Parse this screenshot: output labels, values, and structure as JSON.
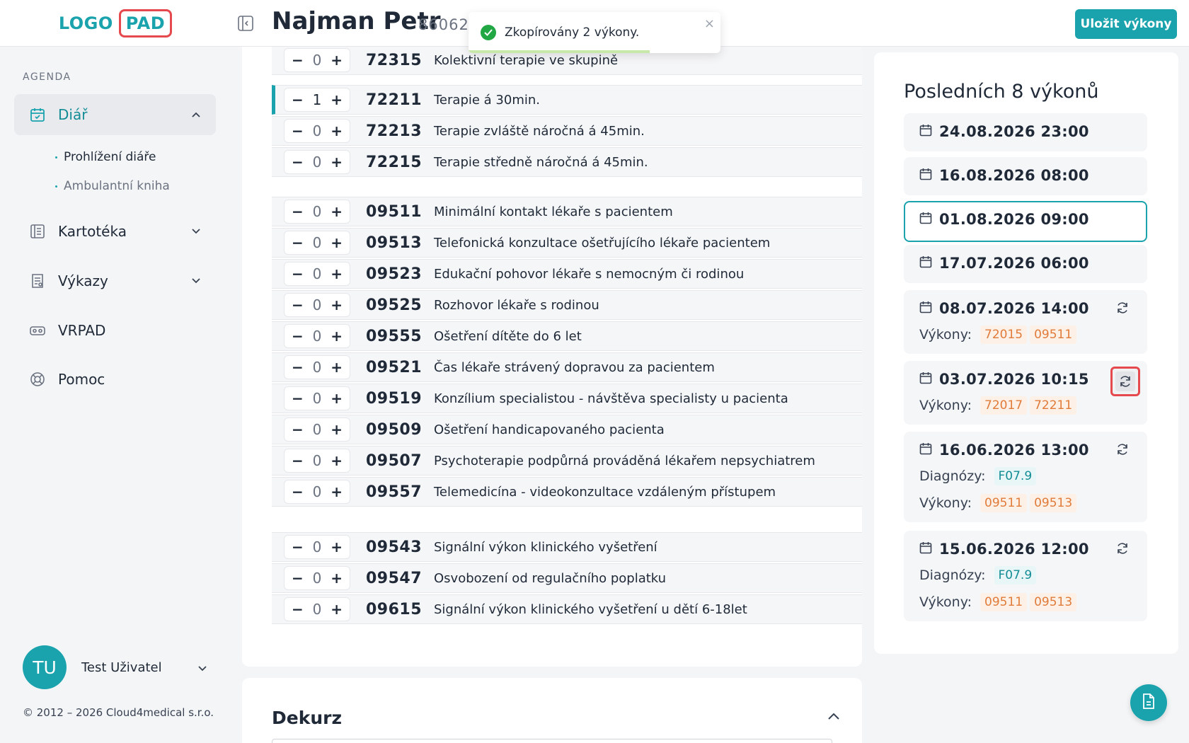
{
  "logo": {
    "part1": "LOGO",
    "part2": "PAD"
  },
  "sidebar": {
    "section_label": "AGENDA",
    "items": [
      {
        "label": "Diář",
        "icon": "calendar-icon"
      },
      {
        "label": "Kartotéka",
        "icon": "card-index-icon"
      },
      {
        "label": "Výkazy",
        "icon": "report-icon"
      },
      {
        "label": "VRPAD",
        "icon": "vr-headset-icon"
      },
      {
        "label": "Pomoc",
        "icon": "lifebuoy-icon"
      }
    ],
    "subitems": [
      {
        "label": "Prohlížení diáře"
      },
      {
        "label": "Ambulantní kniha"
      }
    ],
    "user": {
      "initials": "TU",
      "name": "Test Uživatel"
    },
    "copyright": "© 2012 – 2026 Cloud4medical s.r.o."
  },
  "header": {
    "patient_name": "Najman Petr",
    "patient_id": "860622",
    "save_label": "Uložit výkony"
  },
  "toast": {
    "message": "Zkopírovány 2 výkony.",
    "close": "×",
    "progress": 0.72
  },
  "procedures": [
    {
      "qty": "0",
      "code": "72315",
      "desc": "Kolektivní terapie ve skupině"
    },
    {
      "qty": "1",
      "code": "72211",
      "desc": "Terapie á 30min."
    },
    {
      "qty": "0",
      "code": "72213",
      "desc": "Terapie zvláště náročná á 45min."
    },
    {
      "qty": "0",
      "code": "72215",
      "desc": "Terapie středně náročná á 45min."
    },
    {
      "qty": "0",
      "code": "09511",
      "desc": "Minimální kontakt lékaře s pacientem"
    },
    {
      "qty": "0",
      "code": "09513",
      "desc": "Telefonická konzultace ošetřujícího lékaře pacientem"
    },
    {
      "qty": "0",
      "code": "09523",
      "desc": "Edukační pohovor lékaře s nemocným či rodinou"
    },
    {
      "qty": "0",
      "code": "09525",
      "desc": "Rozhovor lékaře s rodinou"
    },
    {
      "qty": "0",
      "code": "09555",
      "desc": "Ošetření dítěte do 6 let"
    },
    {
      "qty": "0",
      "code": "09521",
      "desc": "Čas lékaře strávený dopravou za pacientem"
    },
    {
      "qty": "0",
      "code": "09519",
      "desc": "Konzílium specialistou - návštěva specialisty u pacienta"
    },
    {
      "qty": "0",
      "code": "09509",
      "desc": "Ošetření handicapovaného pacienta"
    },
    {
      "qty": "0",
      "code": "09507",
      "desc": "Psychoterapie podpůrná prováděná lékařem nepsychiatrem"
    },
    {
      "qty": "0",
      "code": "09557",
      "desc": "Telemedicína - videokonzultace vzdáleným přístupem"
    },
    {
      "qty": "0",
      "code": "09543",
      "desc": "Signální výkon klinického vyšetření"
    },
    {
      "qty": "0",
      "code": "09547",
      "desc": "Osvobození od regulačního poplatku"
    },
    {
      "qty": "0",
      "code": "09615",
      "desc": "Signální výkon klinického vyšetření u dětí 6-18let"
    }
  ],
  "stepper": {
    "minus": "−",
    "plus": "+"
  },
  "dekurz": {
    "title": "Dekurz"
  },
  "recent": {
    "title": "Posledních 8 výkonů",
    "label_vykony": "Výkony:",
    "label_diagnozy": "Diagnózy:",
    "entries": [
      {
        "date": "24.08.2026 23:00"
      },
      {
        "date": "16.08.2026 08:00"
      },
      {
        "date": "01.08.2026 09:00",
        "selected": true
      },
      {
        "date": "17.07.2026 06:00"
      },
      {
        "date": "08.07.2026 14:00",
        "vykony": [
          "72015",
          "09511"
        ]
      },
      {
        "date": "03.07.2026 10:15",
        "vykony": [
          "72017",
          "72211"
        ]
      },
      {
        "date": "16.06.2026 13:00",
        "diagnozy": [
          "F07.9"
        ],
        "vykony": [
          "09511",
          "09513"
        ]
      },
      {
        "date": "15.06.2026 12:00",
        "diagnozy": [
          "F07.9"
        ],
        "vykony": [
          "09511",
          "09513"
        ]
      }
    ]
  },
  "colors": {
    "accent": "#1aa3ad",
    "highlight": "#e5484d",
    "tag_orange": "#e07b3a"
  }
}
